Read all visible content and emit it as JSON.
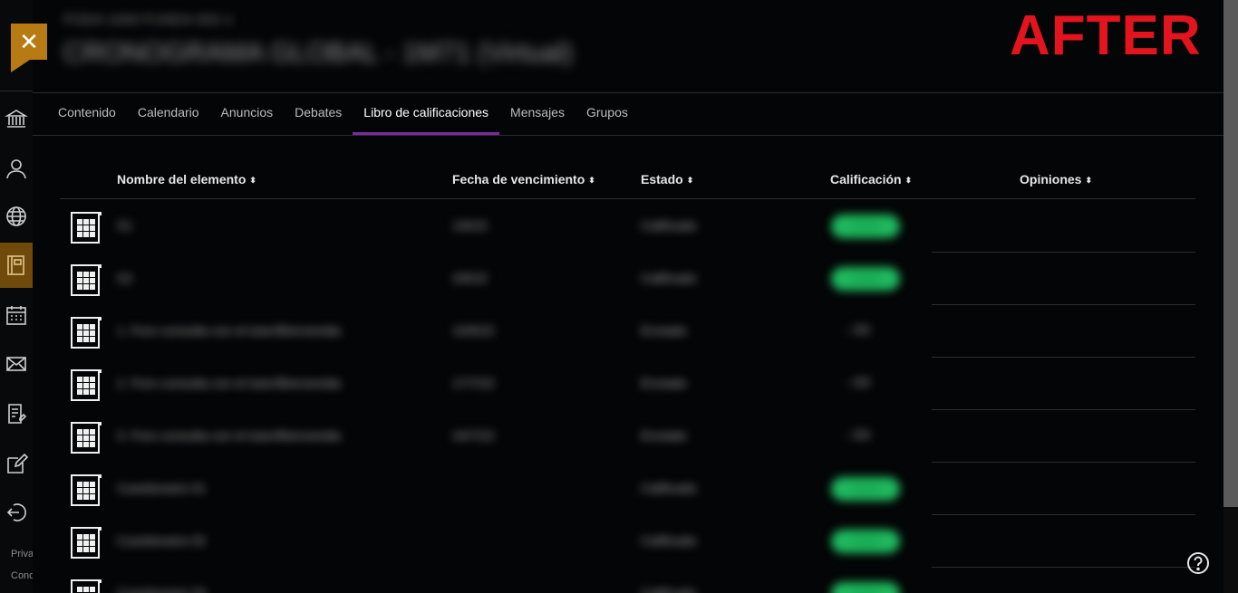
{
  "header": {
    "course_subtitle": "FODA 1000 FUNDA 002-1",
    "course_title": "CRONOGRAMA GLOBAL - 1M71 (Virtual)",
    "annotation": "AFTER"
  },
  "close_label": "✕",
  "rail": {
    "items": [
      {
        "name": "institution-icon"
      },
      {
        "name": "profile-icon"
      },
      {
        "name": "globe-icon"
      },
      {
        "name": "courses-icon",
        "active": true
      },
      {
        "name": "calendar-icon"
      },
      {
        "name": "messages-icon"
      },
      {
        "name": "grades-icon"
      },
      {
        "name": "edit-icon"
      },
      {
        "name": "sign-out-icon"
      }
    ],
    "footer_privacy": "Privacy",
    "footer_conditions": "Conditions"
  },
  "tabs": [
    {
      "label": "Contenido",
      "active": false
    },
    {
      "label": "Calendario",
      "active": false
    },
    {
      "label": "Anuncios",
      "active": false
    },
    {
      "label": "Debates",
      "active": false
    },
    {
      "label": "Libro de calificaciones",
      "active": true
    },
    {
      "label": "Mensajes",
      "active": false
    },
    {
      "label": "Grupos",
      "active": false
    }
  ],
  "table": {
    "columns": {
      "name": "Nombre del elemento",
      "due": "Fecha de vencimiento",
      "status": "Estado",
      "grade": "Calificación",
      "feedback": "Opiniones"
    },
    "sort_glyph": "⬍",
    "rows": [
      {
        "name": "S1",
        "due": "1/6/22",
        "status": "Calificado",
        "grade": "20/20",
        "grade_style": "pill"
      },
      {
        "name": "S2",
        "due": "2/6/22",
        "status": "Calificado",
        "grade": "20/20",
        "grade_style": "pill"
      },
      {
        "name": "1. Foro consulta con el tutor/Bienvenida",
        "due": "10/6/22",
        "status": "Enviado",
        "grade": "- /20",
        "grade_style": "text"
      },
      {
        "name": "2. Foro consulta con el tutor/Bienvenida",
        "due": "17/7/22",
        "status": "Enviado",
        "grade": "- /20",
        "grade_style": "text"
      },
      {
        "name": "3. Foro consulta con el tutor/Bienvenida",
        "due": "24/7/22",
        "status": "Enviado",
        "grade": "- /20",
        "grade_style": "text"
      },
      {
        "name": "Cuestionario 01",
        "due": "",
        "status": "Calificado",
        "grade": "20/20",
        "grade_style": "pill"
      },
      {
        "name": "Cuestionario 02",
        "due": "",
        "status": "Calificado",
        "grade": "20/20",
        "grade_style": "pill"
      },
      {
        "name": "Cuestionario 03",
        "due": "",
        "status": "Calificado",
        "grade": "20/20",
        "grade_style": "pill"
      }
    ]
  },
  "colors": {
    "accent_orange": "#b87a12",
    "tab_underline": "#7b2b9e",
    "grade_green": "#1fb85e",
    "annotation_red": "#e3141d"
  }
}
